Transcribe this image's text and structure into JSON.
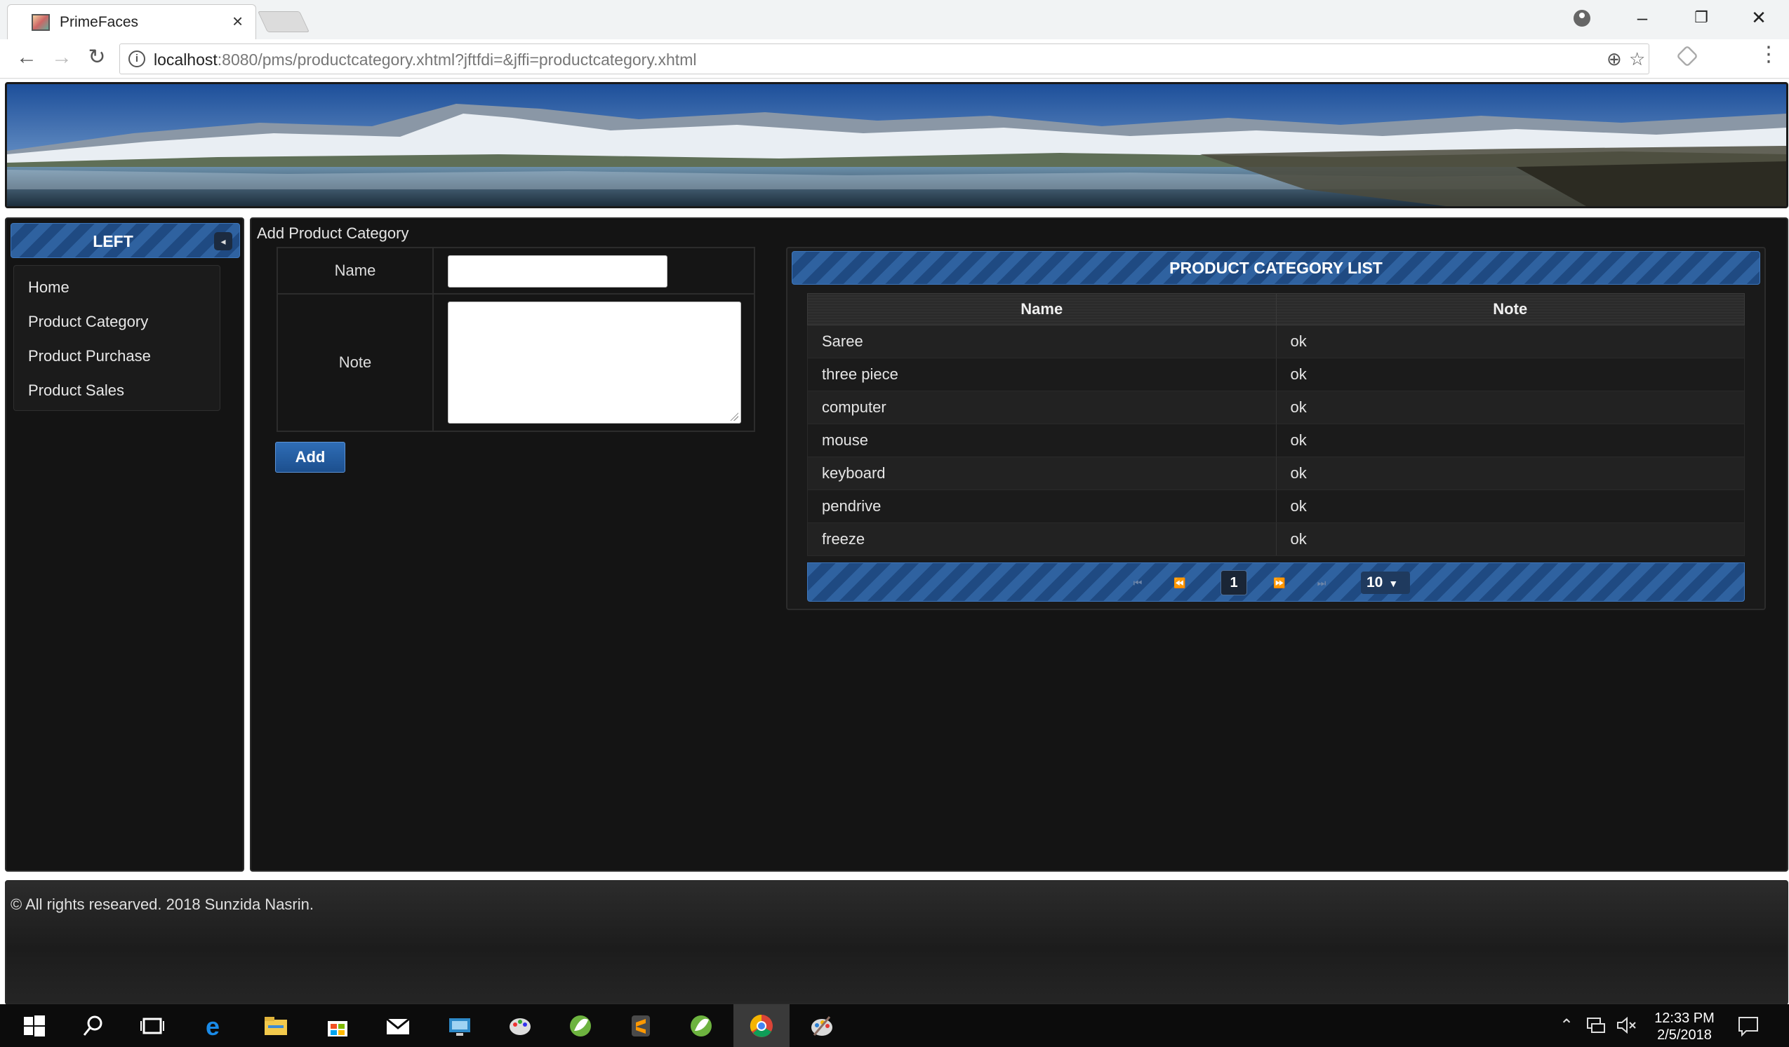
{
  "browser": {
    "tab_title": "PrimeFaces",
    "tab_close": "×",
    "url_host": "localhost",
    "url_rest": ":8080/pms/productcategory.xhtml?jftfdi=&jffi=productcategory.xhtml",
    "back": "←",
    "forward": "→",
    "reload": "↻",
    "zoom": "⊕",
    "bookmark": "☆",
    "menu": "⋮",
    "minimize": "–",
    "restore": "❐",
    "close": "✕"
  },
  "left": {
    "title": "LEFT",
    "collapse": "◂",
    "menu": [
      {
        "label": "Home"
      },
      {
        "label": "Product Category"
      },
      {
        "label": "Product Purchase"
      },
      {
        "label": "Product Sales"
      }
    ]
  },
  "form": {
    "legend": "Add Product Category",
    "name_label": "Name",
    "note_label": "Note",
    "name_value": "",
    "note_value": "",
    "add_label": "Add"
  },
  "list": {
    "title": "PRODUCT CATEGORY LIST",
    "columns": [
      "Name",
      "Note"
    ],
    "rows": [
      {
        "name": "Saree",
        "note": "ok"
      },
      {
        "name": "three piece",
        "note": "ok"
      },
      {
        "name": "computer",
        "note": "ok"
      },
      {
        "name": "mouse",
        "note": "ok"
      },
      {
        "name": "keyboard",
        "note": "ok"
      },
      {
        "name": "pendrive",
        "note": "ok"
      },
      {
        "name": "freeze",
        "note": "ok"
      }
    ],
    "paginator": {
      "current_page": "1",
      "rows_per_page": "10",
      "first": "⏮",
      "prev": "⏪",
      "next": "⏩",
      "last": "⏭"
    }
  },
  "footer": {
    "text": "© All rights researved. 2018 Sunzida Nasrin."
  },
  "taskbar": {
    "time": "12:33 PM",
    "date": "2/5/2018"
  },
  "colors": {
    "header_blue": "#2f62a0",
    "panel_dark": "#141414"
  }
}
